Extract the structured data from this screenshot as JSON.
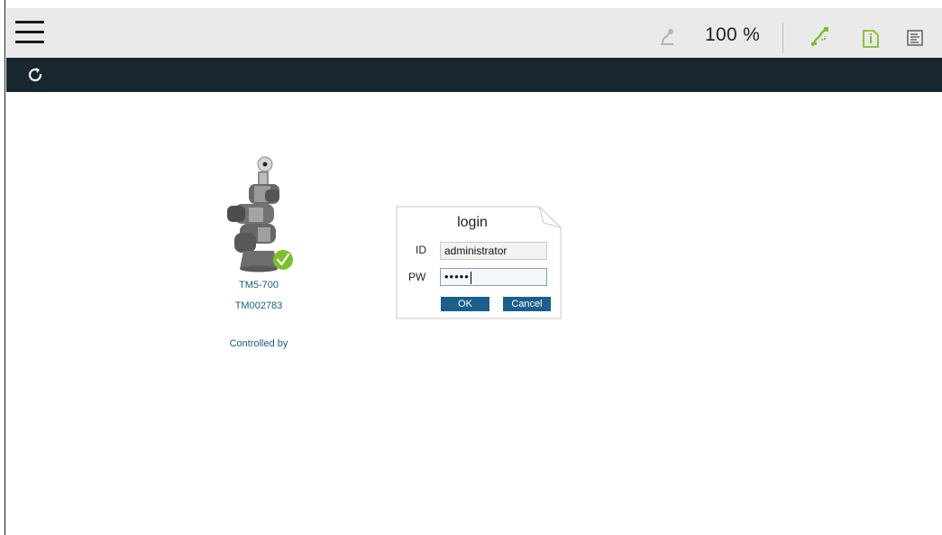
{
  "header": {
    "speed_text": "100 %"
  },
  "robot": {
    "model": "TM5-700",
    "serial": "TM002783",
    "controlled_by_label": "Controlled by"
  },
  "login": {
    "title": "login",
    "id_label": "ID",
    "id_value": "administrator",
    "pw_label": "PW",
    "pw_masked": "•••••",
    "ok_label": "OK",
    "cancel_label": "Cancel"
  },
  "colors": {
    "topbar_bg": "#eaeaea",
    "darkbar_bg": "#18262f",
    "accent_green": "#7cbf2c",
    "link_blue": "#1d5a86",
    "button_blue": "#1b5f8c"
  },
  "icons": [
    "menu-icon",
    "speed-icon",
    "network-icon",
    "info-icon",
    "log-icon",
    "refresh-icon",
    "robot-status-check-icon"
  ]
}
